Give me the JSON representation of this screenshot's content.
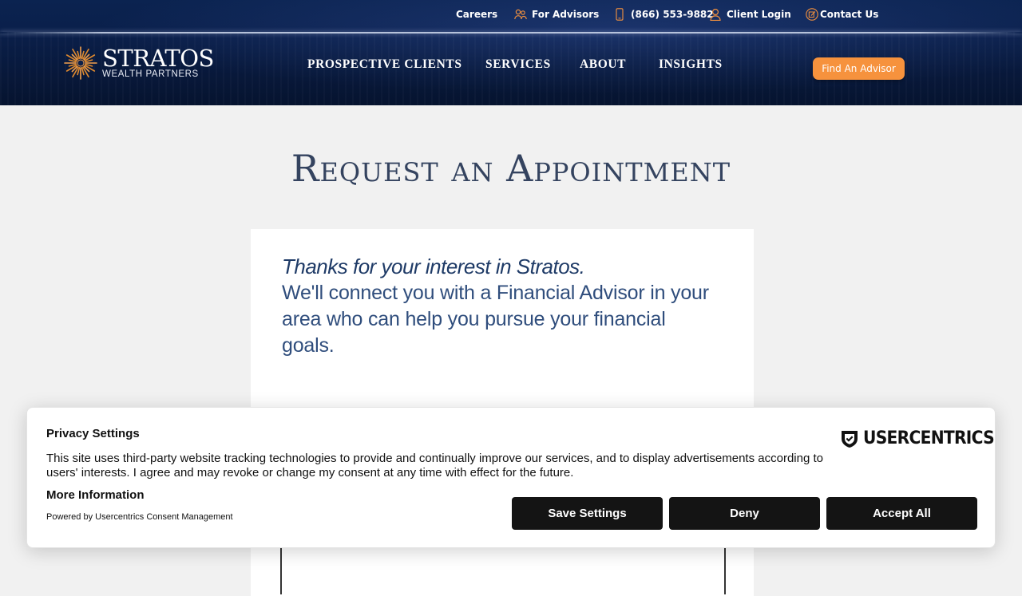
{
  "utility_nav": {
    "careers": "Careers",
    "for_advisors": "For Advisors",
    "phone": "(866) 553-9882",
    "client_login": "Client Login",
    "contact_us": "Contact Us"
  },
  "logo": {
    "name": "STRATOS",
    "tagline": "WEALTH PARTNERS"
  },
  "main_nav": {
    "items": [
      "PROSPECTIVE CLIENTS",
      "SERVICES",
      "ABOUT",
      "INSIGHTS"
    ],
    "cta": "Find An Advisor"
  },
  "page": {
    "title": "Request an Appointment",
    "lead": "Thanks for your interest in Stratos.",
    "body": "We'll connect you with a Financial Advisor in your area who can help you pursue your financial goals."
  },
  "consent": {
    "title": "Privacy Settings",
    "text": "This site uses third-party website tracking technologies to provide and continually improve our services, and to display advertisements according to users' interests. I agree and may revoke or change my consent at any time with effect for the future.",
    "more_info": "More Information",
    "powered_by": "Powered by Usercentrics Consent Management",
    "brand": "USERCENTRICS",
    "buttons": {
      "save": "Save Settings",
      "deny": "Deny",
      "accept": "Accept All"
    }
  },
  "colors": {
    "header_bg": "#0a1f4a",
    "accent_orange": "#f6923d",
    "title_color": "#34435f",
    "body_text": "#2f4d7c",
    "consent_button": "#141414"
  },
  "icons": [
    "advisors-icon",
    "phone-icon",
    "user-icon",
    "contact-icon",
    "sunburst-logo-icon",
    "usercentrics-shield-icon"
  ]
}
